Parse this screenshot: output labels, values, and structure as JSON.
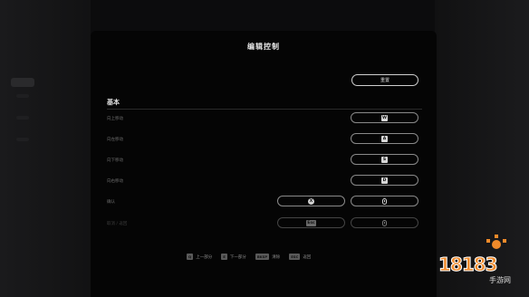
{
  "panel": {
    "title": "编辑控制"
  },
  "reset_label": "重置",
  "section": {
    "title": "基本"
  },
  "rows": [
    {
      "label": "向上移动",
      "key": "W"
    },
    {
      "label": "向左移动",
      "key": "A"
    },
    {
      "label": "向下移动",
      "key": "S"
    },
    {
      "label": "向右移动",
      "key": "D"
    },
    {
      "label": "确认",
      "gamepad": "X",
      "mouse": "mouse-left-icon"
    },
    {
      "label": "取消 / 返回",
      "key": "Esc",
      "mouse": "mouse-right-icon"
    }
  ],
  "footer": {
    "prev": {
      "key": "Q",
      "label": "上一部分"
    },
    "next": {
      "key": "E",
      "label": "下一部分"
    },
    "clear": {
      "key": "BKSP",
      "label": "清除"
    },
    "back": {
      "key": "ESC",
      "label": "返回"
    }
  },
  "watermark": {
    "text": "18183",
    "sub": "手游网"
  }
}
